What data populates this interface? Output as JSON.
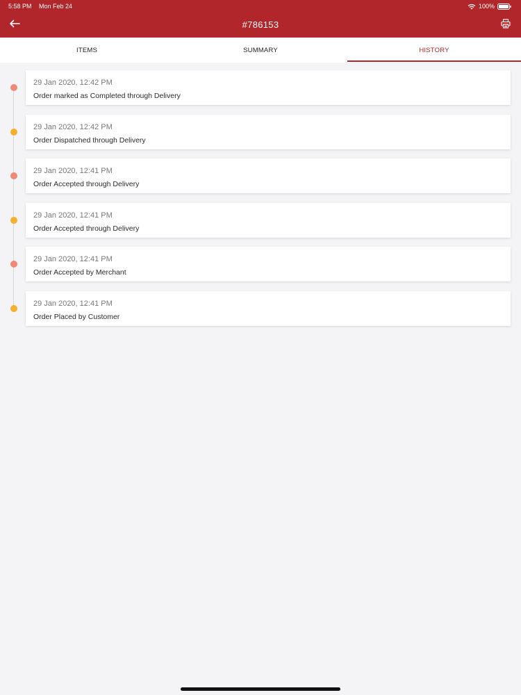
{
  "status_bar": {
    "time": "5:58 PM",
    "date": "Mon Feb 24",
    "battery": "100%"
  },
  "nav": {
    "title": "#786153",
    "back_icon": "arrow-left-icon",
    "print_icon": "printer-icon"
  },
  "tabs": [
    {
      "label": "ITEMS",
      "active": false
    },
    {
      "label": "SUMMARY",
      "active": false
    },
    {
      "label": "HISTORY",
      "active": true
    }
  ],
  "history": [
    {
      "time": "29 Jan 2020, 12:42 PM",
      "description": "Order marked as Completed through Delivery",
      "dot_color": "#f08878"
    },
    {
      "time": "29 Jan 2020, 12:42 PM",
      "description": "Order Dispatched through Delivery",
      "dot_color": "#f5b02c"
    },
    {
      "time": "29 Jan 2020, 12:41 PM",
      "description": "Order Accepted through Delivery",
      "dot_color": "#f08878"
    },
    {
      "time": "29 Jan 2020, 12:41 PM",
      "description": "Order Accepted through Delivery",
      "dot_color": "#f5b02c"
    },
    {
      "time": "29 Jan 2020, 12:41 PM",
      "description": "Order Accepted by Merchant",
      "dot_color": "#f08878"
    },
    {
      "time": "29 Jan 2020, 12:41 PM",
      "description": "Order Placed by Customer",
      "dot_color": "#f5b02c"
    }
  ],
  "colors": {
    "brand": "#b0262a",
    "background": "#f4f3f5",
    "dot_red": "#f08878",
    "dot_orange": "#f5b02c"
  }
}
